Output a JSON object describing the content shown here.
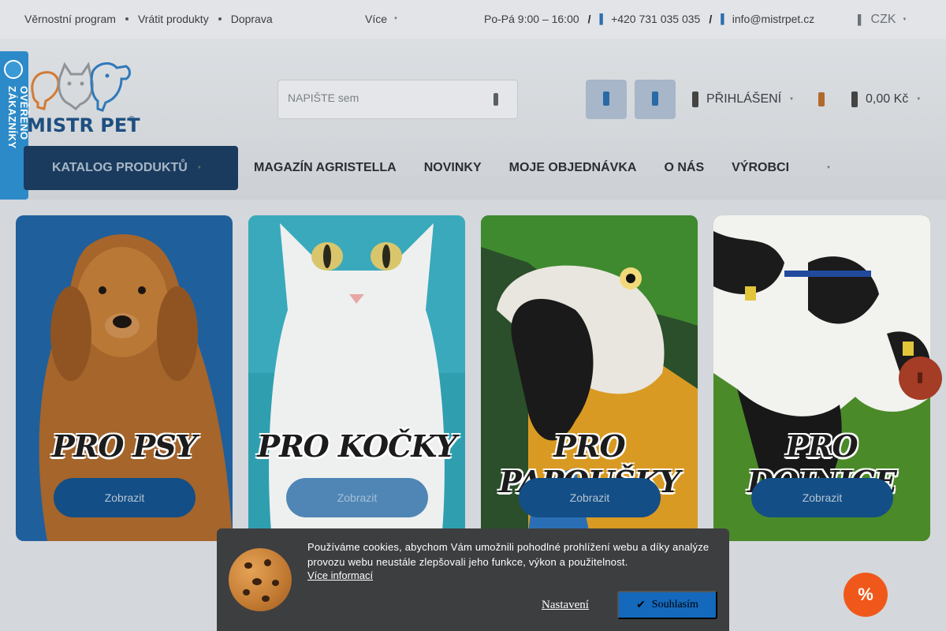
{
  "topbar": {
    "links": [
      "Věrnostní program",
      "Vrátit produkty",
      "Doprava"
    ],
    "more_label": "Více",
    "hours": "Po-Pá 9:00 – 16:00",
    "phone": "+420 731 035 035",
    "email": "info@mistrpet.cz",
    "currency": "CZK"
  },
  "verified_badge": {
    "label": "OVĚŘENO ZÁKAZNÍKY"
  },
  "logo": {
    "text": "MISTR PET"
  },
  "search": {
    "placeholder": "NAPIŠTE sem"
  },
  "header": {
    "login_label": "PŘIHLÁŠENÍ",
    "cart_total": "0,00 Kč"
  },
  "nav": {
    "catalog_label": "KATALOG PRODUKTŮ",
    "items": [
      "MAGAZÍN AGRISTELLA",
      "NOVINKY",
      "MOJE OBJEDNÁVKA",
      "O NÁS",
      "VÝROBCI"
    ]
  },
  "categories": [
    {
      "title": "PRO PSY",
      "button": "Zobrazit"
    },
    {
      "title": "PRO KOČKY",
      "button": "Zobrazit"
    },
    {
      "title": "PRO PAPOUŠKY",
      "button": "Zobrazit"
    },
    {
      "title": "PRO DOJNICE",
      "button": "Zobrazit"
    }
  ],
  "cookie": {
    "message": "Používáme cookies, abychom Vám umožnili pohodlné prohlížení webu a díky analýze provozu webu neustále zlepšovali jeho funkce, výkon a použitelnost.",
    "more_info": "Více informací",
    "settings": "Nastavení",
    "accept": "Souhlasím"
  },
  "promo": {
    "symbol": "%"
  },
  "colors": {
    "brand_blue": "#1a3b5e",
    "accent_orange": "#f0581b",
    "accept_blue": "#1469bd"
  }
}
